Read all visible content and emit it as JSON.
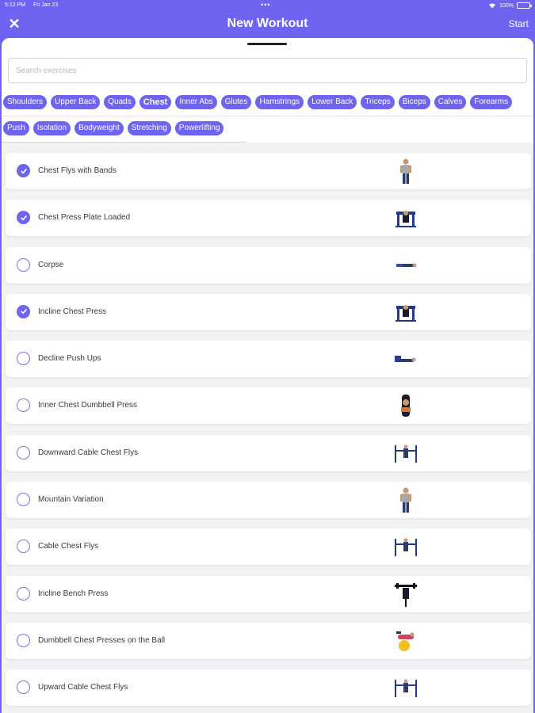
{
  "status": {
    "time": "5:12 PM",
    "date": "Fri Jan 23",
    "battery": "100%",
    "dots": "•••"
  },
  "nav": {
    "title": "New Workout",
    "close_label": "✕",
    "start_label": "Start"
  },
  "search": {
    "placeholder": "Search exercises",
    "value": ""
  },
  "muscle_chips": [
    "Shoulders",
    "Upper Back",
    "Quads",
    "Chest",
    "Inner Abs",
    "Glutes",
    "Hamstrings",
    "Lower Back",
    "Triceps",
    "Biceps",
    "Calves",
    "Forearms"
  ],
  "selected_muscle": "Chest",
  "type_chips": [
    "Push",
    "Isolation",
    "Bodyweight",
    "Stretching",
    "Powerlifting"
  ],
  "colors": {
    "accent": "#6f63f2",
    "background": "#f2f2f5"
  },
  "exercises": [
    {
      "name": "Chest Flys with Bands",
      "checked": true,
      "icon": "person-standing-icon"
    },
    {
      "name": "Chest Press Plate Loaded",
      "checked": true,
      "icon": "machine-press-icon"
    },
    {
      "name": "Corpse",
      "checked": false,
      "icon": "person-lying-icon"
    },
    {
      "name": "Incline Chest Press",
      "checked": true,
      "icon": "machine-press-icon"
    },
    {
      "name": "Decline Push Ups",
      "checked": false,
      "icon": "pushup-icon"
    },
    {
      "name": "Inner Chest Dumbbell Press",
      "checked": false,
      "icon": "dumbbell-press-icon"
    },
    {
      "name": "Downward Cable Chest Flys",
      "checked": false,
      "icon": "cable-machine-icon"
    },
    {
      "name": "Mountain Variation",
      "checked": false,
      "icon": "person-standing-icon"
    },
    {
      "name": "Cable Chest Flys",
      "checked": false,
      "icon": "cable-machine-icon"
    },
    {
      "name": "Incline Bench Press",
      "checked": false,
      "icon": "bench-press-icon"
    },
    {
      "name": "Dumbbell Chest Presses on the Ball",
      "checked": false,
      "icon": "ball-press-icon"
    },
    {
      "name": "Upward Cable Chest Flys",
      "checked": false,
      "icon": "cable-machine-icon"
    }
  ]
}
